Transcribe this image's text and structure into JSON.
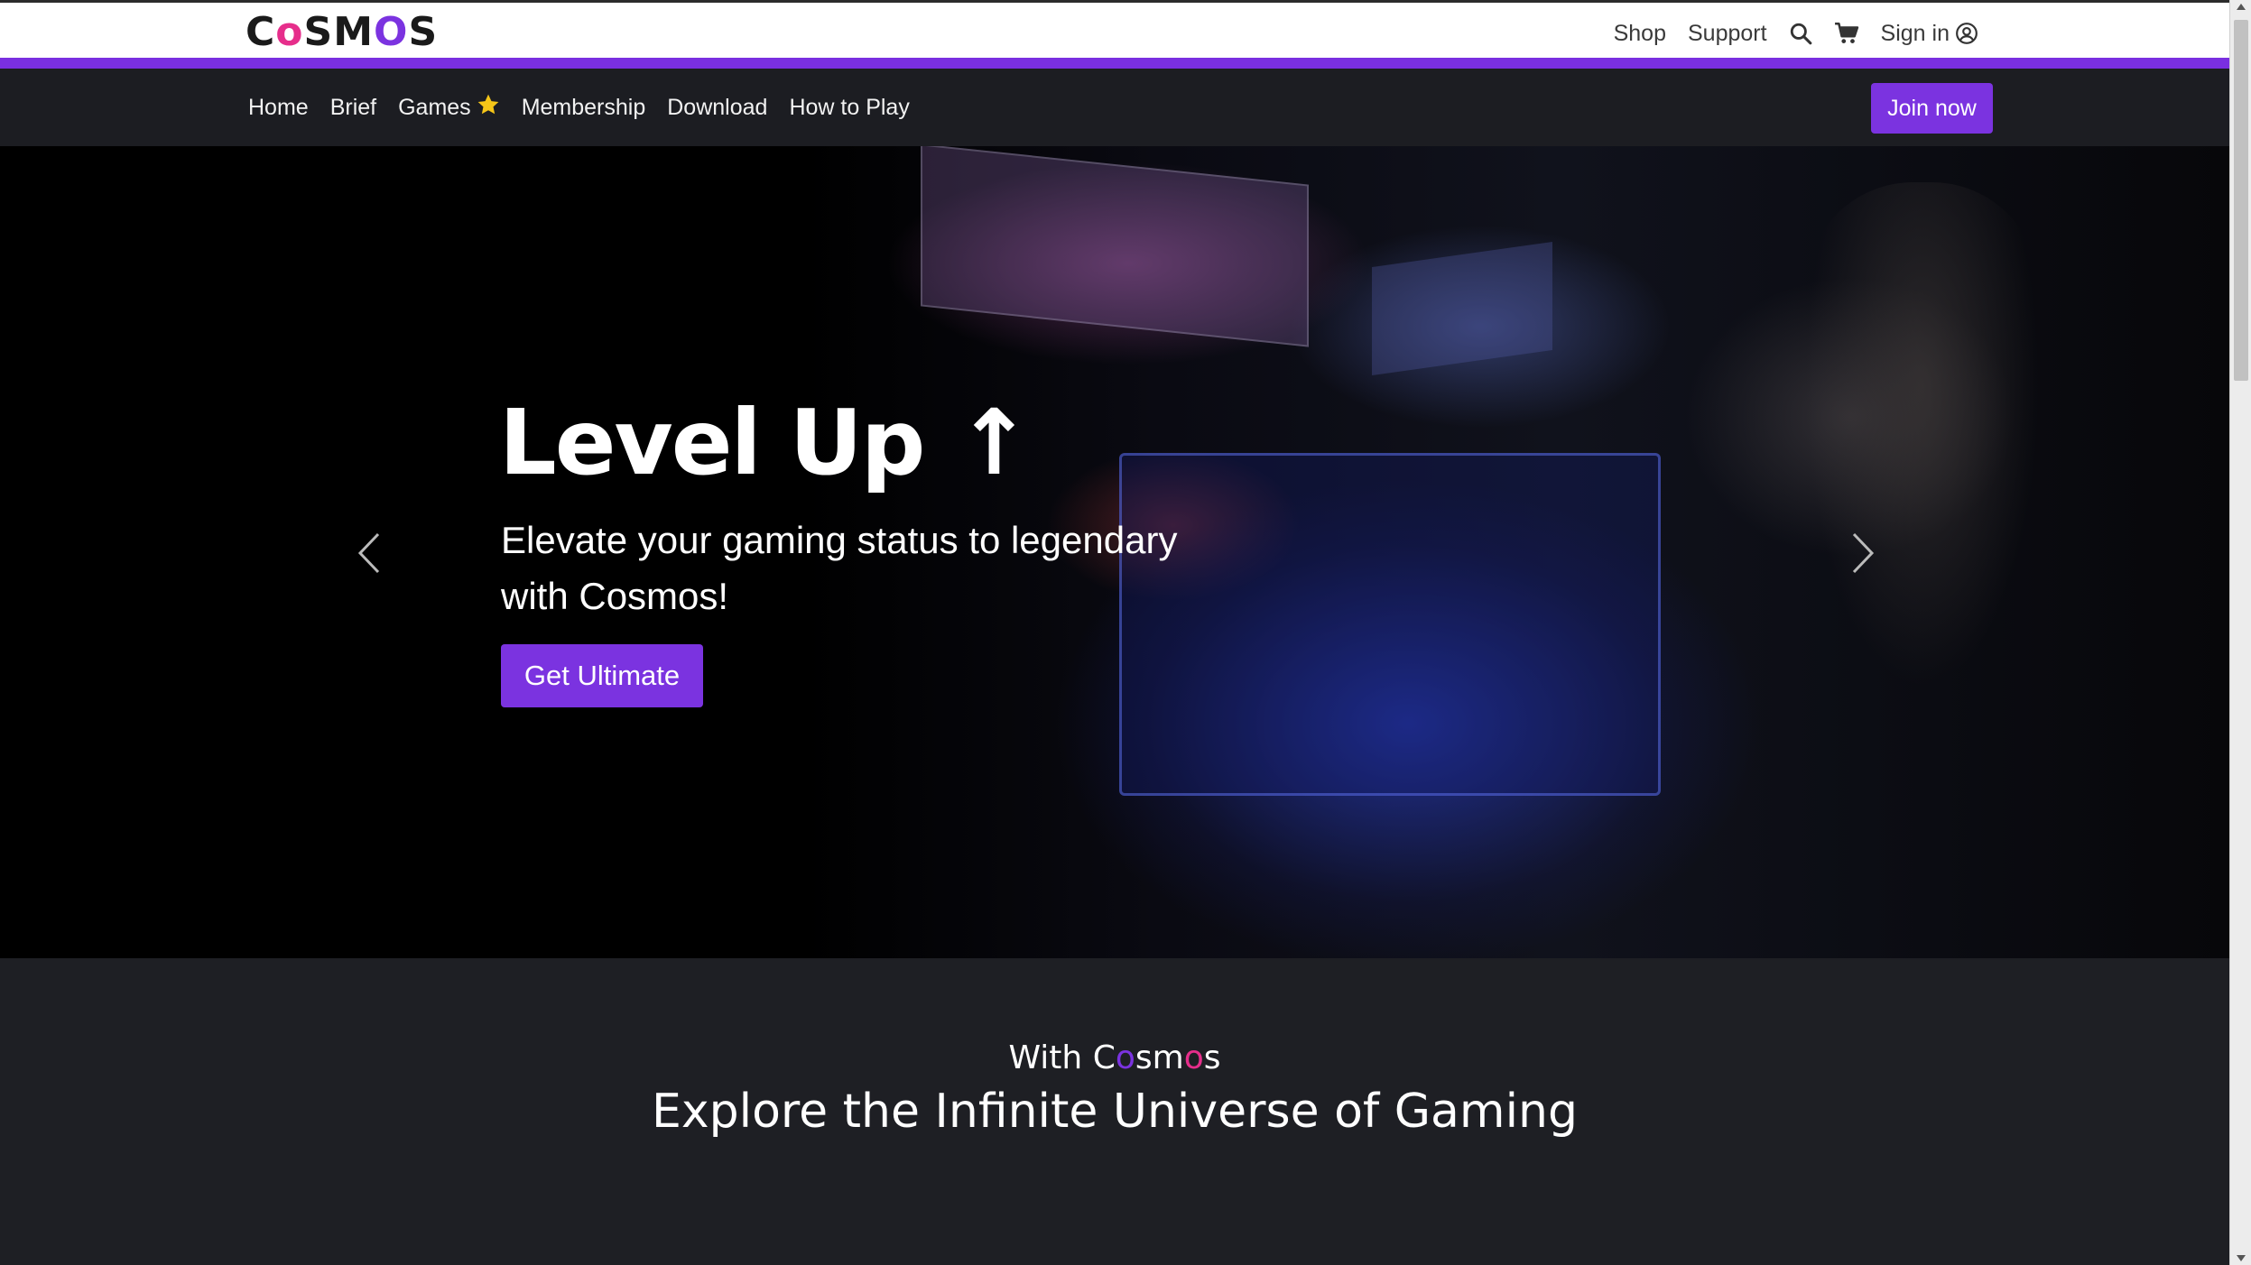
{
  "brand": {
    "logo_parts": [
      "C",
      "o",
      "S",
      "M",
      "O",
      "S"
    ],
    "logo_colors": [
      "#1a1a1a",
      "#e62e8b",
      "#1a1a1a",
      "#1a1a1a",
      "#7b33e0",
      "#1a1a1a"
    ]
  },
  "topnav": {
    "shop": "Shop",
    "support": "Support",
    "search_icon": "search-icon",
    "cart_icon": "cart-icon",
    "signin": "Sign in",
    "user_icon": "user-circle-icon"
  },
  "nav": {
    "items": [
      {
        "label": "Home"
      },
      {
        "label": "Brief"
      },
      {
        "label": "Games",
        "icon": "star-icon"
      },
      {
        "label": "Membership"
      },
      {
        "label": "Download"
      },
      {
        "label": "How to Play"
      }
    ],
    "join": "Join now"
  },
  "hero": {
    "title": "Level Up",
    "title_symbol": "↑",
    "subtitle": "Elevate your gaming status to legendary with Cosmos!",
    "cta": "Get Ultimate",
    "prev_icon": "chevron-left-icon",
    "next_icon": "chevron-right-icon"
  },
  "section": {
    "kicker_prefix": "With ",
    "kicker_c": "C",
    "kicker_o1": "o",
    "kicker_sm": "sm",
    "kicker_o2": "o",
    "kicker_s": "s",
    "headline": "Explore the Infinite Universe of Gaming"
  },
  "colors": {
    "accent": "#7b33e0",
    "pink": "#e62e8b",
    "navbar": "#1c1d22",
    "section_bg": "#1e1f24"
  }
}
